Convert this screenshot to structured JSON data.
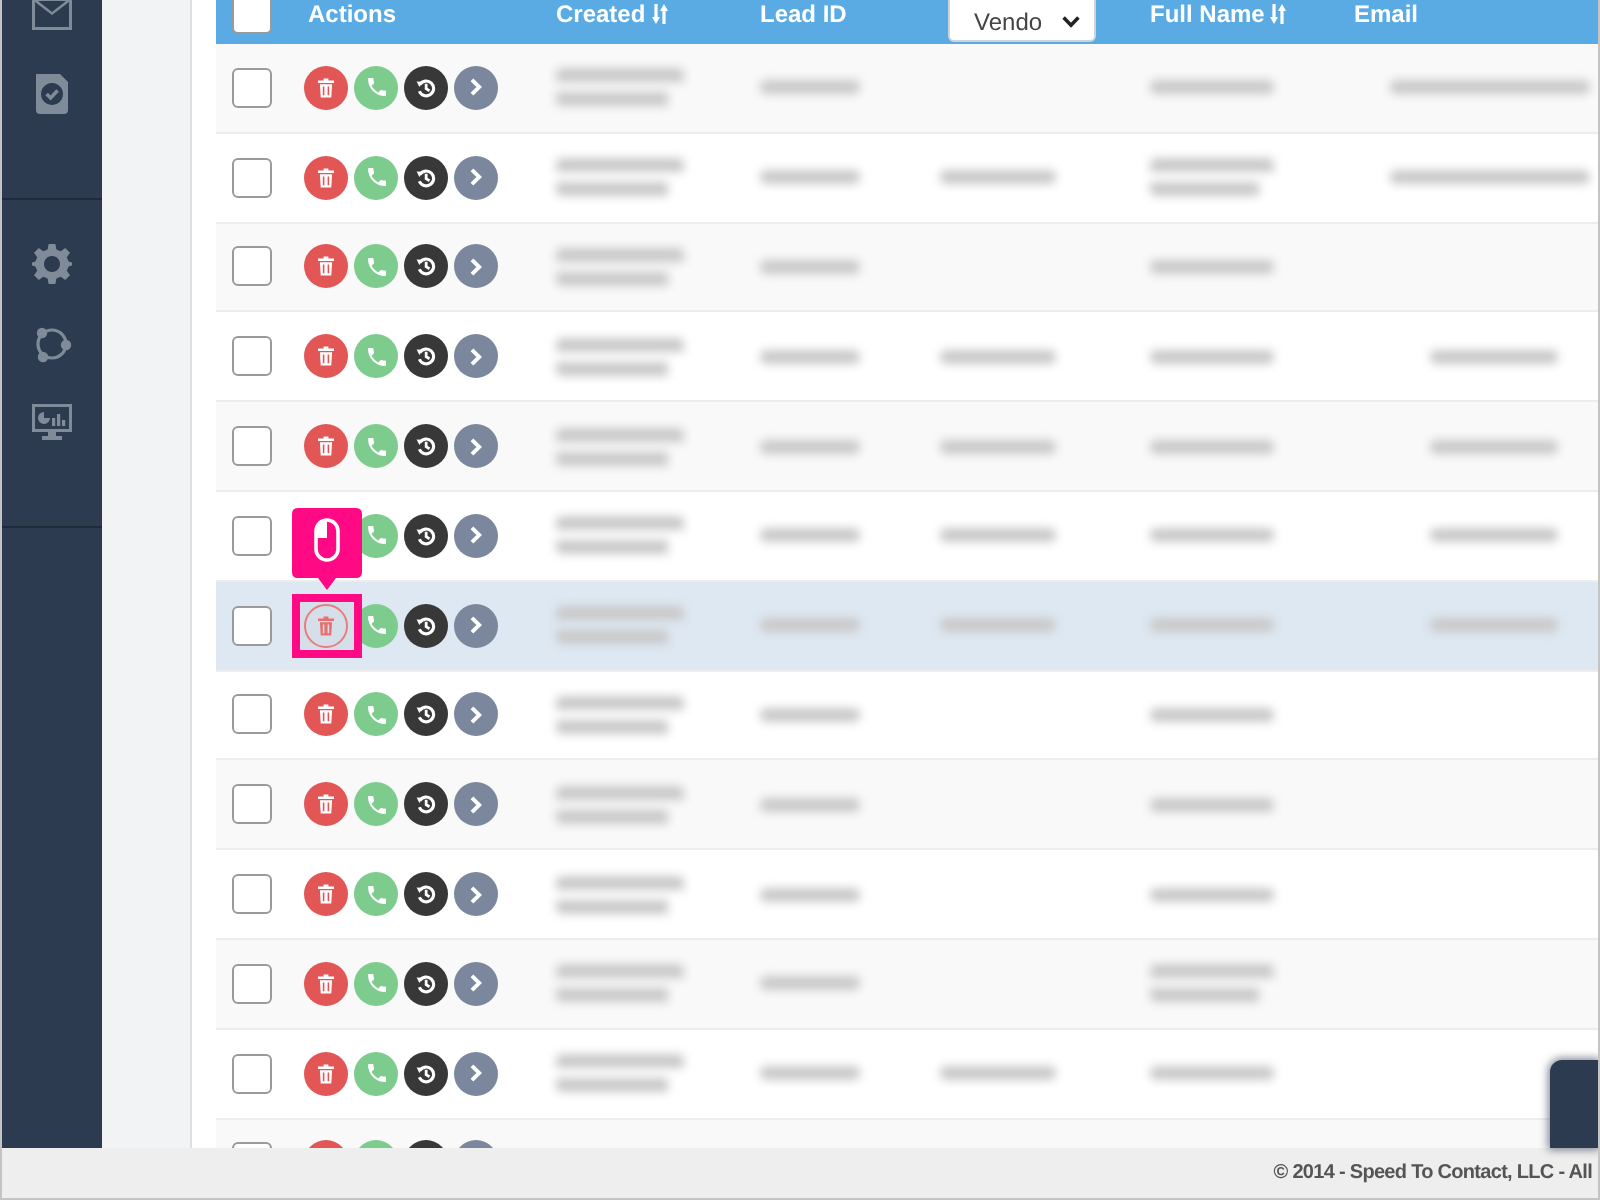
{
  "table": {
    "header_checkbox": {
      "checked": false
    },
    "columns": [
      {
        "label": "Actions",
        "kind": "text"
      },
      {
        "label": "Created",
        "kind": "sortable"
      },
      {
        "label": "Lead ID",
        "kind": "text"
      },
      {
        "label": "Vendo",
        "kind": "select"
      },
      {
        "label": "Full Name",
        "kind": "sortable"
      },
      {
        "label": "Email",
        "kind": "text"
      }
    ],
    "rows": [
      {
        "checked": false,
        "highlighted": false,
        "click_marker": false,
        "cells": {
          "created": {
            "kind": "blurred-double"
          },
          "lead_id": {
            "kind": "blurred"
          },
          "full_name": {
            "kind": "blurred"
          },
          "email": {
            "kind": "blurred-wide"
          }
        }
      },
      {
        "checked": false,
        "highlighted": false,
        "click_marker": false,
        "cells": {
          "created": {
            "kind": "blurred-double"
          },
          "lead_id": {
            "kind": "blurred"
          },
          "vendor": {
            "kind": "blurred"
          },
          "full_name": {
            "kind": "blurred-double"
          },
          "email": {
            "kind": "blurred-wide"
          }
        }
      },
      {
        "checked": false,
        "highlighted": false,
        "click_marker": false,
        "cells": {
          "created": {
            "kind": "blurred-double"
          },
          "lead_id": {
            "kind": "blurred"
          },
          "full_name": {
            "kind": "blurred"
          }
        }
      },
      {
        "checked": false,
        "highlighted": false,
        "click_marker": false,
        "cells": {
          "created": {
            "kind": "blurred-double"
          },
          "lead_id": {
            "kind": "blurred"
          },
          "vendor": {
            "kind": "blurred"
          },
          "full_name": {
            "kind": "blurred"
          },
          "email": {
            "kind": "blurred"
          }
        }
      },
      {
        "checked": false,
        "highlighted": false,
        "click_marker": false,
        "cells": {
          "created": {
            "kind": "blurred-double"
          },
          "lead_id": {
            "kind": "blurred"
          },
          "vendor": {
            "kind": "blurred"
          },
          "full_name": {
            "kind": "blurred"
          },
          "email": {
            "kind": "blurred"
          }
        }
      },
      {
        "checked": false,
        "highlighted": false,
        "click_marker": false,
        "cells": {
          "created": {
            "kind": "blurred-double"
          },
          "lead_id": {
            "kind": "blurred"
          },
          "vendor": {
            "kind": "blurred"
          },
          "full_name": {
            "kind": "blurred"
          },
          "email": {
            "kind": "blurred"
          }
        }
      },
      {
        "checked": false,
        "highlighted": true,
        "click_marker": true,
        "cells": {
          "created": {
            "kind": "blurred-double"
          },
          "lead_id": {
            "kind": "blurred"
          },
          "vendor": {
            "kind": "blurred"
          },
          "full_name": {
            "kind": "blurred"
          },
          "email": {
            "kind": "blurred"
          }
        }
      },
      {
        "checked": false,
        "highlighted": false,
        "click_marker": false,
        "cells": {
          "created": {
            "kind": "blurred-double"
          },
          "lead_id": {
            "kind": "blurred"
          },
          "full_name": {
            "kind": "blurred"
          }
        }
      },
      {
        "checked": false,
        "highlighted": false,
        "click_marker": false,
        "cells": {
          "created": {
            "kind": "blurred-double"
          },
          "lead_id": {
            "kind": "blurred"
          },
          "full_name": {
            "kind": "blurred"
          }
        }
      },
      {
        "checked": false,
        "highlighted": false,
        "click_marker": false,
        "cells": {
          "created": {
            "kind": "blurred-double"
          },
          "lead_id": {
            "kind": "blurred"
          },
          "full_name": {
            "kind": "blurred"
          }
        }
      },
      {
        "checked": false,
        "highlighted": false,
        "click_marker": false,
        "cells": {
          "created": {
            "kind": "blurred-double"
          },
          "lead_id": {
            "kind": "blurred"
          },
          "full_name": {
            "kind": "blurred-double"
          }
        }
      },
      {
        "checked": false,
        "highlighted": false,
        "click_marker": false,
        "cells": {
          "created": {
            "kind": "blurred-double"
          },
          "lead_id": {
            "kind": "blurred"
          },
          "vendor": {
            "kind": "blurred"
          },
          "full_name": {
            "kind": "blurred"
          }
        }
      },
      {
        "checked": false,
        "highlighted": false,
        "click_marker": false
      }
    ]
  },
  "footer": {
    "text": "© 2014 - Speed To Contact, LLC - All"
  }
}
